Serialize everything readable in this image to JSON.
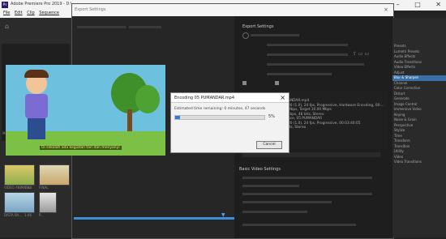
{
  "app": {
    "title": "Adobe Premiere Pro 2019 - D:\\",
    "logo": "Pr",
    "menus": [
      "File",
      "Edit",
      "Clip",
      "Sequence"
    ]
  },
  "window_controls": {
    "minimize": "–",
    "maximize": "□",
    "close": "✕"
  },
  "export_dialog": {
    "title": "Export Settings",
    "export_settings_header": "Export Settings",
    "basic_video_settings": "Basic Video Settings",
    "video_tab": "Video",
    "close": "×"
  },
  "encoding_dialog": {
    "title": "Encoding 05 PUMANDAR.mp4",
    "status": "Estimated time remaining: 0 minutes, 47 seconds",
    "progress_percent": 5,
    "progress_label": "5%",
    "close": "×",
    "cancel_label": "Cancel"
  },
  "summary_lines": [
    "ANDAR.mp4",
    "80 (1.0), 24 fps, Progressive, Hardware Encoding, 00:...",
    "Mbps, Target 10.00 Mbps",
    "kbps, 48 kHz, Stereo",
    "nce, 05 PUMANDAR",
    "80 (1.0), 24 fps, Progressive, 00:03:40:05",
    "Hz, Stereo"
  ],
  "preview": {
    "subtitle": "Di sekolah ada kegiatan tari dan menyanyi"
  },
  "project_panel": {
    "label": "Media Browser",
    "clips": [
      {
        "name": "VIDEO ANIMASI...",
        "duration": "1:48"
      },
      {
        "name": "FINAL",
        "duration": ""
      },
      {
        "name": "DISTA BA...",
        "duration": "1:46"
      },
      {
        "name": "P...",
        "duration": ""
      }
    ]
  },
  "effects_list": [
    "Presets",
    "Lumetri Presets",
    "Audio Effects",
    "Audio Transitions",
    "Video Effects",
    "Adjust",
    "Blur & Sharpen",
    "Channel",
    "Color Correction",
    "Distort",
    "Generate",
    "Image Control",
    "Immersive Video",
    "Keying",
    "Noise & Grain",
    "Perspective",
    "Stylize",
    "Time",
    "Transform",
    "Transition",
    "Utility",
    "Video",
    "Video Transitions"
  ],
  "effects_selected_index": 6
}
